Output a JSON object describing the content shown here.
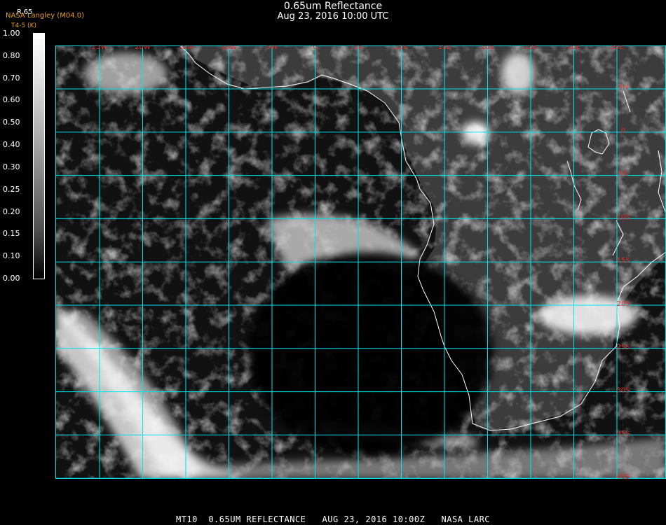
{
  "header": {
    "title": "0.65um Reflectance",
    "subtitle": "Aug 23, 2016 10:00 UTC",
    "credit": "NASA Langley (M04.0)",
    "colorbar_top_label": "R.65",
    "colorbar_unit": "T4-5 (K)"
  },
  "colorbar": {
    "labels": [
      "1.00",
      "0.80",
      "0.70",
      "0.60",
      "0.50",
      "0.40",
      "0.30",
      "0.25",
      "0.20",
      "0.15",
      "0.10",
      "0.00"
    ]
  },
  "map": {
    "lon_labels": [
      "25W",
      "20W",
      "15W",
      "10W",
      "5W",
      "0",
      "5E",
      "10E",
      "15E",
      "20E",
      "25E",
      "30E",
      "35E"
    ],
    "lat_labels": [
      "5N",
      "0",
      "5S",
      "10S",
      "15S",
      "20S",
      "25S",
      "30S",
      "35S",
      "40S"
    ],
    "grid_color": "#00e5ee",
    "coast_color": "#ffffff",
    "label_color": "#e03030"
  },
  "footer": {
    "text": "MT10  0.65UM REFLECTANCE   AUG 23, 2016 10:00Z   NASA LARC"
  }
}
